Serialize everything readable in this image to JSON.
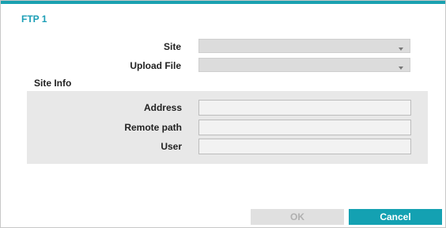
{
  "dialog": {
    "title": "FTP 1"
  },
  "form": {
    "site_label": "Site",
    "upload_file_label": "Upload File"
  },
  "site_info": {
    "title": "Site Info",
    "address_label": "Address",
    "remote_path_label": "Remote path",
    "user_label": "User"
  },
  "buttons": {
    "ok_label": "OK",
    "cancel_label": "Cancel"
  },
  "colors": {
    "accent": "#14a1b2",
    "disabled_button": "#e0e0e0"
  }
}
